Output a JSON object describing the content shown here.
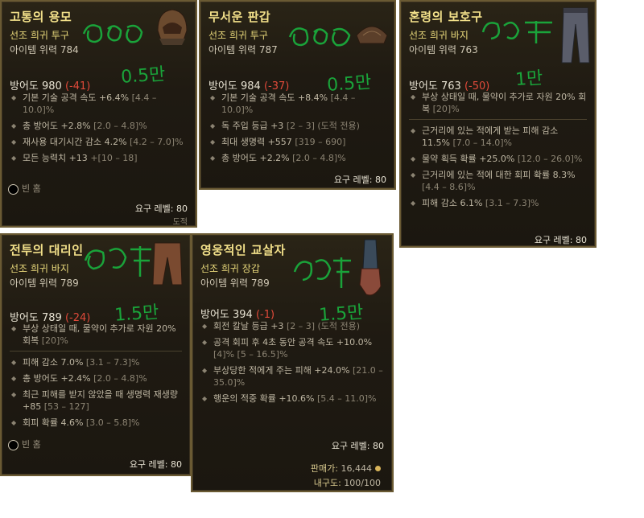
{
  "cards": [
    {
      "title": "고통의 용모",
      "rarity": "선조 희귀 투구",
      "power": "아이템 위력 784",
      "armor_label": "방어도 980",
      "armor_delta": "-41",
      "stats": [
        {
          "text": "기본 기술 공격 속도 +6.4%",
          "range": "[4.4 – 10.0]%"
        },
        {
          "text": "총 방어도 +2.8%",
          "range": "[2.0 – 4.8]%"
        },
        {
          "text": "재사용 대기시간 감소 4.2%",
          "range": "[4.2 – 7.0]%"
        },
        {
          "text": "모든 능력치 +13",
          "range": "+[10 – 18]"
        }
      ],
      "socket": "빈 홈",
      "req": "요구 레벨: 80",
      "note": "도적",
      "annotation": "0.5만"
    },
    {
      "title": "무서운 판갑",
      "rarity": "선조 희귀 투구",
      "power": "아이템 위력 787",
      "armor_label": "방어도 984",
      "armor_delta": "-37",
      "stats": [
        {
          "text": "기본 기술 공격 속도 +8.4%",
          "range": "[4.4 – 10.0]%"
        },
        {
          "text": "독 주입 등급 +3",
          "range": "[2 – 3] (도적 전용)"
        },
        {
          "text": "최대 생명력 +557",
          "range": "[319 – 690]"
        },
        {
          "text": "총 방어도 +2.2%",
          "range": "[2.0 – 4.8]%"
        }
      ],
      "req": "요구 레벨: 80",
      "annotation": "0.5만"
    },
    {
      "title": "혼령의 보호구",
      "rarity": "선조 희귀 바지",
      "power": "아이템 위력 763",
      "armor_label": "방어도 763",
      "armor_delta": "-50",
      "implicit": {
        "text": "부상 상태일 때, 물약이 추가로 자원 20% 회복",
        "range": "[20]%"
      },
      "stats": [
        {
          "text": "근거리에 있는 적에게 받는 피해 감소 11.5%",
          "range": "[7.0 – 14.0]%"
        },
        {
          "text": "물약 획득 확률 +25.0%",
          "range": "[12.0 – 26.0]%"
        },
        {
          "text": "근거리에 있는 적에 대한 회피 확률 8.3%",
          "range": "[4.4 – 8.6]%"
        },
        {
          "text": "피해 감소 6.1%",
          "range": "[3.1 – 7.3]%"
        }
      ],
      "req": "요구 레벨: 80",
      "annotation": "1만"
    },
    {
      "title": "전투의 대리인",
      "rarity": "선조 희귀 바지",
      "power": "아이템 위력 789",
      "armor_label": "방어도 789",
      "armor_delta": "-24",
      "implicit": {
        "text": "부상 상태일 때, 물약이 추가로 자원 20% 회복",
        "range": "[20]%"
      },
      "stats": [
        {
          "text": "피해 감소 7.0%",
          "range": "[3.1 – 7.3]%"
        },
        {
          "text": "총 방어도 +2.4%",
          "range": "[2.0 – 4.8]%"
        },
        {
          "text": "최근 피해를 받지 않았을 때 생명력 재생량 +85",
          "range": "[53 – 127]"
        },
        {
          "text": "회피 확률 4.6%",
          "range": "[3.0 – 5.8]%"
        }
      ],
      "socket": "빈 홈",
      "req": "요구 레벨: 80",
      "annotation": "1.5만"
    },
    {
      "title": "영웅적인 교살자",
      "rarity": "선조 희귀 장갑",
      "power": "아이템 위력 789",
      "armor_label": "방어도 394",
      "armor_delta": "-1",
      "stats": [
        {
          "text": "회전 칼날 등급 +3",
          "range": "[2 – 3] (도적 전용)"
        },
        {
          "text": "공격 회피 후 4초 동안 공격 속도 +10.0%",
          "range": "[4]% [5 – 16.5]%"
        },
        {
          "text": "부상당한 적에게 주는 피해 +24.0%",
          "range": "[21.0 – 35.0]%"
        },
        {
          "text": "행운의 적중 확률 +10.6%",
          "range": "[5.4 – 11.0]%"
        }
      ],
      "req": "요구 레벨: 80",
      "price_label": "판매가:",
      "price_value": "16,444",
      "durability_label": "내구도:",
      "durability_value": "100/100",
      "annotation": "1.5만"
    }
  ]
}
